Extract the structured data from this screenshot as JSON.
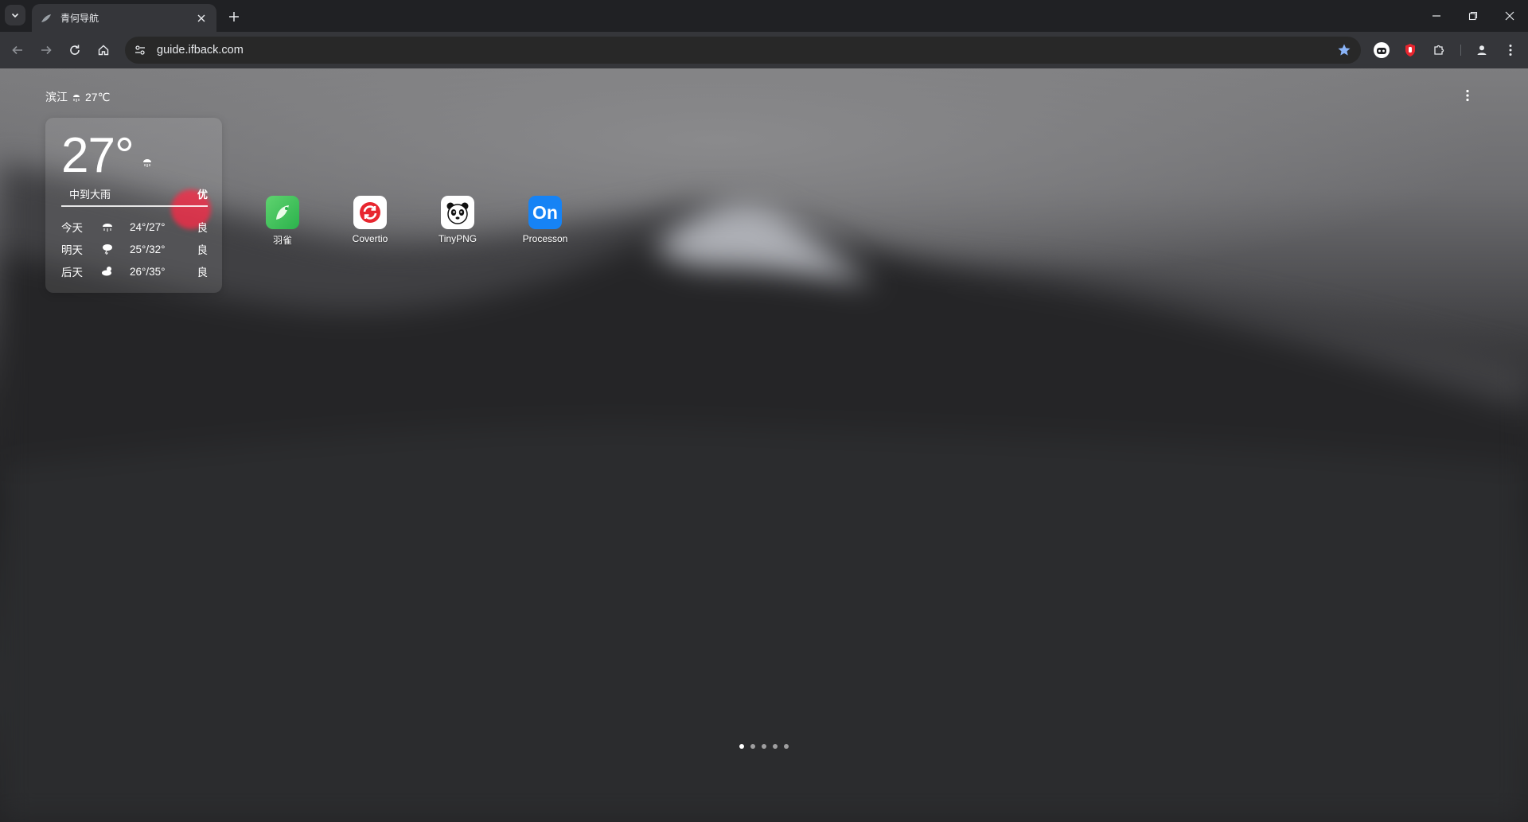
{
  "browser": {
    "tab": {
      "title": "青何导航",
      "favicon": "leaf-icon"
    },
    "url": "guide.ifback.com"
  },
  "weather": {
    "city": "滨江",
    "current_temp_header": "27℃",
    "current_temp_big": "27°",
    "description": "中到大雨",
    "aqi": "优",
    "forecast": [
      {
        "day": "今天",
        "icon": "rain-icon",
        "range": "24°/27°",
        "aqi": "良"
      },
      {
        "day": "明天",
        "icon": "thunder-rain-icon",
        "range": "25°/32°",
        "aqi": "良"
      },
      {
        "day": "后天",
        "icon": "partly-cloudy-icon",
        "range": "26°/35°",
        "aqi": "良"
      }
    ]
  },
  "apps": [
    {
      "label": "羽雀",
      "icon": "yuque-icon",
      "color": "#3ec55a"
    },
    {
      "label": "Covertio",
      "icon": "convertio-icon",
      "color": "#ffffff"
    },
    {
      "label": "TinyPNG",
      "icon": "panda-icon",
      "color": "#ffffff"
    },
    {
      "label": "Processon",
      "icon": "processon-icon",
      "color": "#1683f5",
      "glyph": "On"
    }
  ],
  "pagination": {
    "pages": 5,
    "active": 1
  }
}
